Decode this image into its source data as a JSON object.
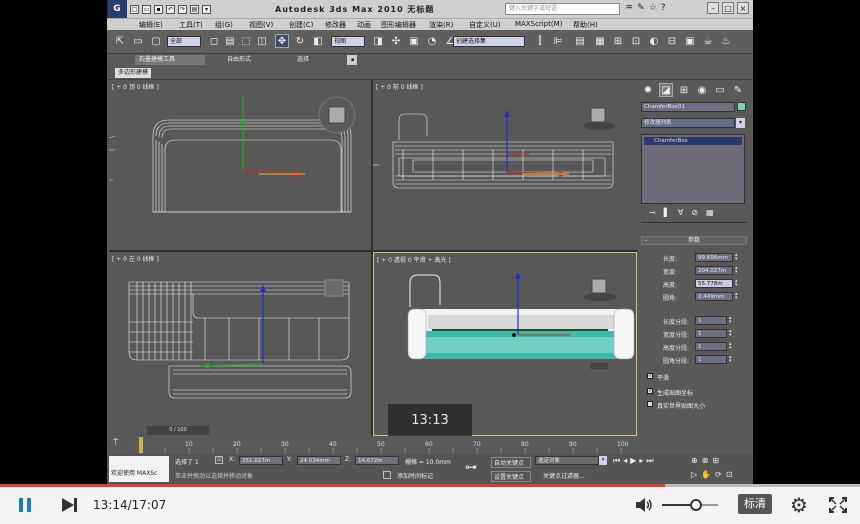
{
  "window": {
    "app_title": "Autodesk 3ds Max  2010    无标题",
    "search_placeholder": "键入关键字或短语",
    "logo": "G"
  },
  "menubar": {
    "items": [
      "编辑(E)",
      "工具(T)",
      "组(G)",
      "视图(V)",
      "创建(C)",
      "修改器",
      "动画",
      "图形编辑器",
      "渲染(R)",
      "自定义(U)",
      "MAXScript(M)",
      "帮助(H)"
    ]
  },
  "toolbar": {
    "selection_filter": "全部",
    "view_dropdown": "视图",
    "named_selection": "创建选择集"
  },
  "ribbon": {
    "tabs": [
      "石墨建模工具",
      "自由形式",
      "选择"
    ],
    "subtab": "多边形建模"
  },
  "viewports": {
    "top": "[ + 0 顶 0 线框 ]",
    "front": "[ + 0 前 0 线框 ]",
    "left": "[ + 0 左 0 线框 ]",
    "perspective": "[ + 0 透视 0 平滑 + 高光 ]"
  },
  "command_panel": {
    "object_name": "ChamferBox01",
    "modifier_list": "修改器列表",
    "stack_item": "ChamferBox",
    "rollout_title": "参数",
    "params": [
      {
        "label": "长度:",
        "value": "99.606mm"
      },
      {
        "label": "宽度:",
        "value": "204.027m"
      },
      {
        "label": "高度:",
        "value": "55.778m"
      },
      {
        "label": "圆角:",
        "value": "2.449mm"
      }
    ],
    "segments": [
      {
        "label": "长度分段:",
        "value": "1"
      },
      {
        "label": "宽度分段:",
        "value": "1"
      },
      {
        "label": "高度分段:",
        "value": "1"
      },
      {
        "label": "圆角分段:",
        "value": "1"
      }
    ],
    "checks": [
      {
        "label": "平滑",
        "checked": true
      },
      {
        "label": "生成贴图坐标",
        "checked": true
      },
      {
        "label": "真实世界贴图大小",
        "checked": false
      }
    ]
  },
  "timeline": {
    "frame_display": "0 / 100",
    "ticks": [
      "10",
      "20",
      "30",
      "40",
      "50",
      "60",
      "70",
      "80",
      "90",
      "100"
    ]
  },
  "status": {
    "welcome": "欢迎使用  MAXSc",
    "selected": "选择了 1",
    "x": "251.027m",
    "y": "24.034mm",
    "z": "14.672m",
    "grid": "栅格 = 10.0mm",
    "prompt": "单击并拖动以选择并移动对象",
    "add_time_tag": "添加时间标记",
    "auto_key": "自动关键点",
    "set_key": "设置关键点",
    "selected_obj": "选定对象",
    "key_filter": "关键点过滤器..."
  },
  "video": {
    "overlay_time": "13:13",
    "current_time": "13:14",
    "duration": "17:07",
    "time_display": "13:14/17:07",
    "quality": "标清",
    "progress": 0.7731,
    "volume": 0.6,
    "accent": "#e23c2a"
  }
}
